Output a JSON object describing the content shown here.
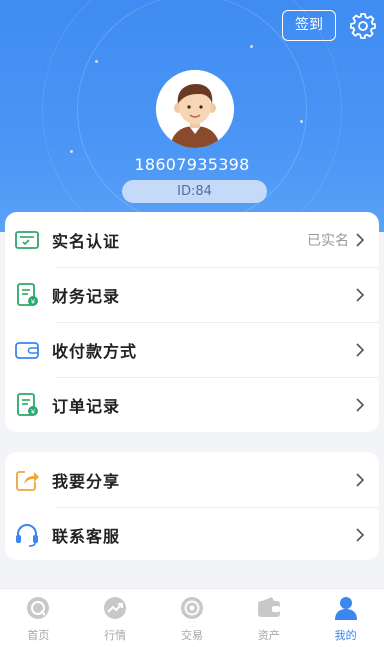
{
  "header": {
    "signin_label": "签到",
    "phone": "18607935398",
    "id_label": "ID:84"
  },
  "menu": {
    "items": [
      {
        "label": "实名认证",
        "status": "已实名",
        "icon": "id-card-icon"
      },
      {
        "label": "财务记录",
        "status": "",
        "icon": "finance-record-icon"
      },
      {
        "label": "收付款方式",
        "status": "",
        "icon": "wallet-icon"
      },
      {
        "label": "订单记录",
        "status": "",
        "icon": "order-record-icon"
      }
    ],
    "items2": [
      {
        "label": "我要分享",
        "icon": "share-icon"
      },
      {
        "label": "联系客服",
        "icon": "headset-icon"
      }
    ]
  },
  "nav": {
    "tabs": [
      {
        "label": "首页",
        "icon": "home-icon"
      },
      {
        "label": "行情",
        "icon": "market-icon"
      },
      {
        "label": "交易",
        "icon": "trade-icon"
      },
      {
        "label": "资产",
        "icon": "assets-icon"
      },
      {
        "label": "我的",
        "icon": "profile-icon",
        "active": true
      }
    ]
  },
  "colors": {
    "accent": "#3b86f0",
    "header_bg": "#4a95f5",
    "green_icon": "#2ca86a",
    "orange_icon": "#f0a63a"
  }
}
